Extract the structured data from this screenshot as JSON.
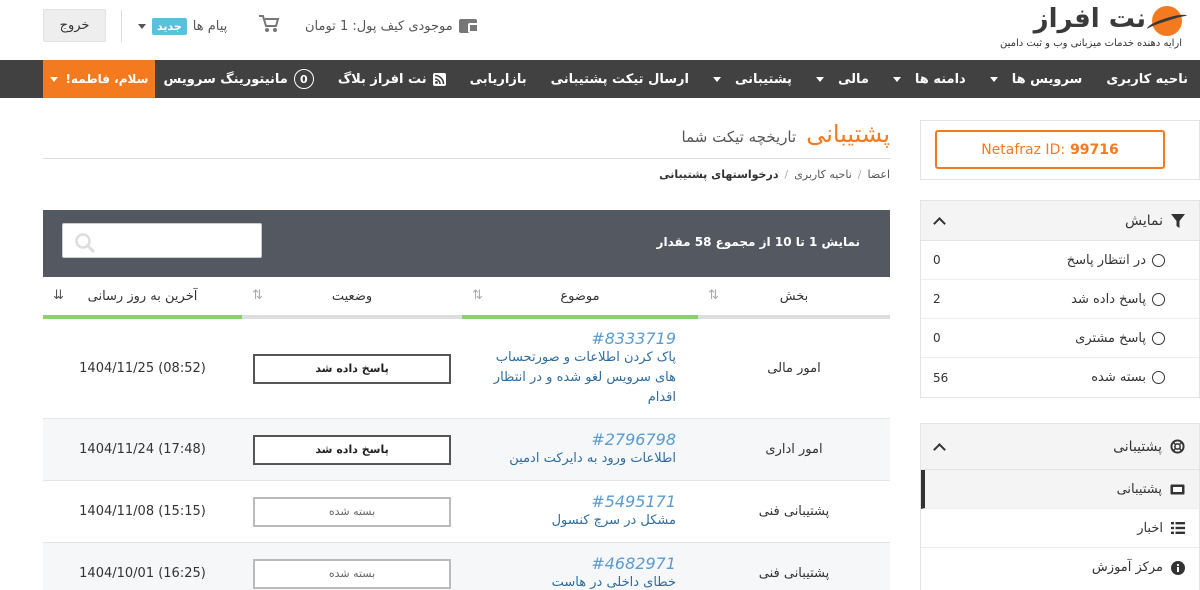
{
  "header": {
    "brand": "نت افراز",
    "tagline": "ارایه دهنده خدمات میزبانی وب و ثبت دامین",
    "wallet_text": "موجودی کیف پول: 1 تومان",
    "messages_label": "پیام ها",
    "messages_badge": "جدید",
    "logout_label": "خروج"
  },
  "nav": {
    "items": [
      {
        "label": "ناحیه کاربری"
      },
      {
        "label": "سرویس ها"
      },
      {
        "label": "دامنه ها"
      },
      {
        "label": "مالی"
      },
      {
        "label": "پشتیبانی"
      },
      {
        "label": "ارسال تیکت پشتیبانی"
      },
      {
        "label": "بازاریابی"
      },
      {
        "label": "نت افراز بلاگ"
      },
      {
        "label": "مانیتورینگ سرویس",
        "count": "0"
      }
    ],
    "greeting": "سلام، فاطمه!"
  },
  "sidebar": {
    "id_label": "Netafraz ID:",
    "id_value": "99716",
    "filter_title": "نمایش",
    "filters": [
      {
        "label": "در انتظار پاسخ",
        "count": "0"
      },
      {
        "label": "پاسخ داده شد",
        "count": "2"
      },
      {
        "label": "پاسخ مشتری",
        "count": "0"
      },
      {
        "label": "بسته شده",
        "count": "56"
      }
    ],
    "support_title": "پشتیبانی",
    "support_items": [
      {
        "label": "پشتیبانی"
      },
      {
        "label": "اخبار"
      },
      {
        "label": "مرکز آموزش"
      }
    ]
  },
  "main": {
    "title": "پشتیبانی",
    "subtitle": "تاریخچه تیکت شما",
    "breadcrumb": [
      "اعضا",
      "ناحیه کاربری",
      "درخواستهای پشتیبانی"
    ],
    "table_info": "نمایش 1 تا 10 از مجموع 58 مقدار",
    "columns": [
      "بخش",
      "موضوع",
      "وضعیت",
      "آخرین به روز رسانی"
    ],
    "rows": [
      {
        "dept": "امور مالی",
        "id": "#8333719",
        "subject": "پاک کردن اطلاعات و صورتحساب های سرویس لغو شده و در انتظار اقدام",
        "status": "پاسخ داده شد",
        "updated": "1404/11/25 (08:52)"
      },
      {
        "dept": "امور اداری",
        "id": "#2796798",
        "subject": "اطلاعات ورود به دایرکت ادمین",
        "status": "پاسخ داده شد",
        "updated": "1404/11/24 (17:48)"
      },
      {
        "dept": "پشتیبانی فنی",
        "id": "#5495171",
        "subject": "مشکل در سرچ کنسول",
        "status": "بسته شده",
        "updated": "1404/11/08 (15:15)"
      },
      {
        "dept": "پشتیبانی فنی",
        "id": "#4682971",
        "subject": "خطای داخلی در هاست",
        "status": "بسته شده",
        "updated": "1404/10/01 (16:25)"
      }
    ]
  },
  "colors": {
    "accent": "#f47a20",
    "navbar": "#414141",
    "table_header": "#545961",
    "sort_bar": "#8ad06e",
    "link": "#5b9bd1"
  }
}
